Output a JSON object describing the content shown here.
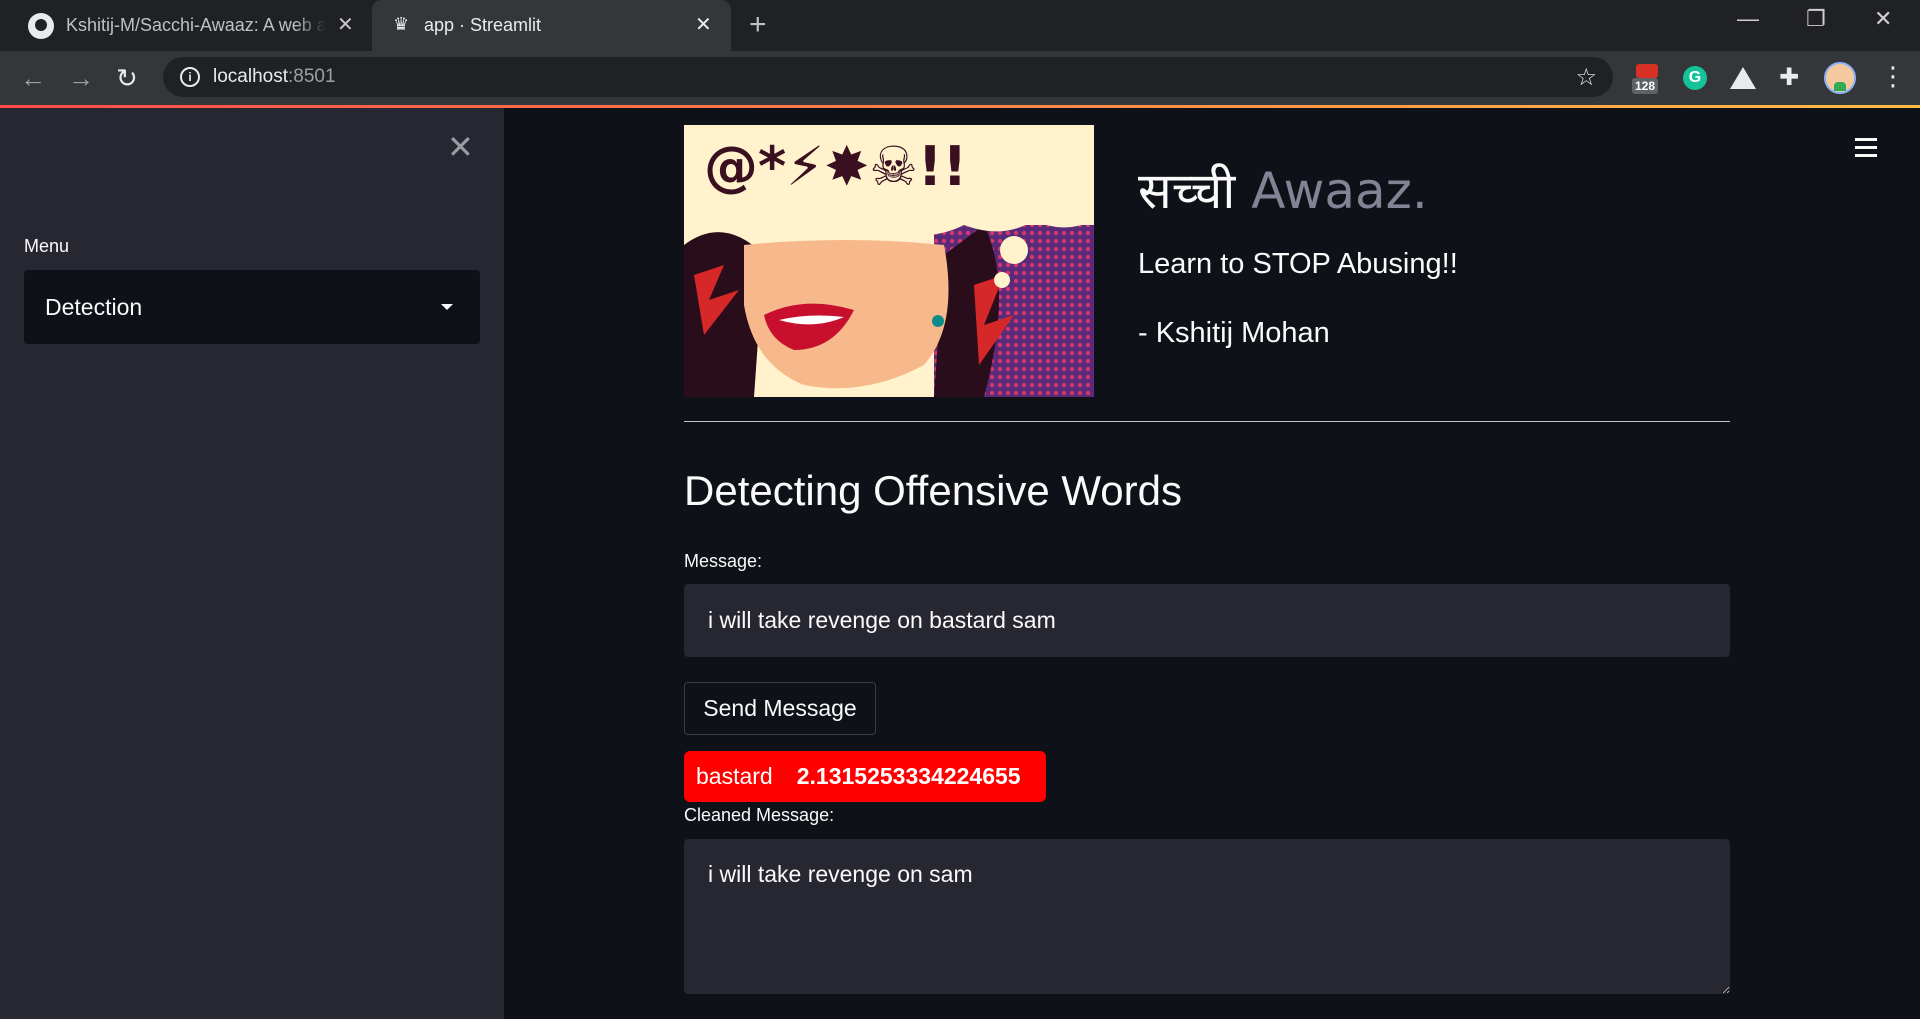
{
  "browser": {
    "tabs": [
      {
        "title": "Kshitij-M/Sacchi-Awaaz: A web app"
      },
      {
        "title": "app · Streamlit"
      }
    ],
    "url_host": "localhost",
    "url_port": ":8501",
    "extension_badge": "128"
  },
  "sidebar": {
    "menu_label": "Menu",
    "selected_option": "Detection"
  },
  "header": {
    "title_hindi": "सच्ची",
    "title_english": "Awaaz.",
    "tagline": "Learn to STOP Abusing!!",
    "author": "- Kshitij Mohan"
  },
  "main": {
    "heading": "Detecting Offensive Words",
    "message_label": "Message:",
    "message_value": "i will take revenge on bastard sam",
    "send_button": "Send Message",
    "detected_word": "bastard",
    "detected_score": "2.1315253334224655",
    "cleaned_label": "Cleaned Message:",
    "cleaned_value": "i will take revenge on sam"
  },
  "colors": {
    "accent_red": "#ff0000",
    "bg": "#0e1117",
    "sidebar_bg": "#262730"
  }
}
